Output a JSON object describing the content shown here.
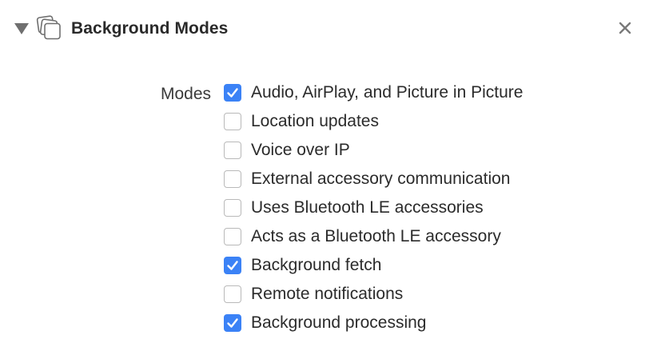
{
  "section": {
    "title": "Background Modes",
    "icon": "stacked-windows-icon",
    "collapse_icon": "disclosure-triangle-down-icon",
    "close_icon": "close-x-icon",
    "expanded": true
  },
  "modes": {
    "label": "Modes",
    "options": [
      {
        "label": "Audio, AirPlay, and Picture in Picture",
        "checked": true
      },
      {
        "label": "Location updates",
        "checked": false
      },
      {
        "label": "Voice over IP",
        "checked": false
      },
      {
        "label": "External accessory communication",
        "checked": false
      },
      {
        "label": "Uses Bluetooth LE accessories",
        "checked": false
      },
      {
        "label": "Acts as a Bluetooth LE accessory",
        "checked": false
      },
      {
        "label": "Background fetch",
        "checked": true
      },
      {
        "label": "Remote notifications",
        "checked": false
      },
      {
        "label": "Background processing",
        "checked": true
      }
    ]
  },
  "colors": {
    "checkbox_checked": "#3b82f6",
    "checkbox_border": "#b9b9b9",
    "text": "#2b2b2b",
    "icon_gray": "#7a7a7a"
  }
}
